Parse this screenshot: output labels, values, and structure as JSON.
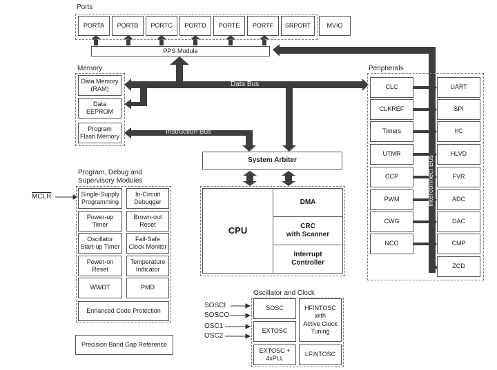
{
  "ports": {
    "label": "Ports",
    "items": [
      "PORTA",
      "PORTB",
      "PORTC",
      "PORTD",
      "PORTE",
      "PORTF",
      "SRPORT"
    ],
    "mvio": "MVIO"
  },
  "pps": "PPS Module",
  "memory": {
    "label": "Memory",
    "items": [
      {
        "line1": "Data Memory",
        "line2": "(RAM)"
      },
      {
        "line1": "Data",
        "line2": "EEPROM"
      },
      {
        "line1": "Program",
        "line2": "Flash Memory"
      }
    ]
  },
  "buses": {
    "data": "Data Bus",
    "instruction": "Instruction Bus",
    "interconnect": "Interconnect Bus"
  },
  "arbiter": "System Arbiter",
  "core": {
    "cpu": "CPU",
    "dma": "DMA",
    "crc": {
      "line1": "CRC",
      "line2": "with Scanner"
    },
    "interrupt": {
      "line1": "Interrupt",
      "line2": "Controller"
    }
  },
  "peripherals": {
    "label": "Peripherals",
    "left": [
      "CLC",
      "CLKREF",
      "Timers",
      "UTMR",
      "CCP",
      "PWM",
      "CWG",
      "NCO"
    ],
    "right": [
      "UART",
      "SPI",
      "I²C",
      "HLVD",
      "FVR",
      "ADC",
      "DAC",
      "CMP",
      "ZCD"
    ]
  },
  "supervisory": {
    "label_line1": "Program, Debug and",
    "label_line2": "Supervisory Modules",
    "mclr": "MCLR",
    "items": [
      {
        "line1": "Single-Supply",
        "line2": "Programming"
      },
      {
        "line1": "In-Circuit",
        "line2": "Debugger"
      },
      {
        "line1": "Power-up",
        "line2": "Timer"
      },
      {
        "line1": "Brown-out",
        "line2": "Reset"
      },
      {
        "line1": "Oscillator",
        "line2": "Start-up Timer"
      },
      {
        "line1": "Fail-Safe",
        "line2": "Clock Monitor"
      },
      {
        "line1": "Power-on",
        "line2": "Reset"
      },
      {
        "line1": "Temperature",
        "line2": "Indicator"
      },
      {
        "line1": "WWDT",
        "line2": ""
      },
      {
        "line1": "PMD",
        "line2": ""
      }
    ],
    "ecp": "Enhanced Code Protection"
  },
  "bandgap": "Precision Band Gap Reference",
  "oscillator": {
    "label": "Oscillator and Clock",
    "signals": [
      "SOSCI",
      "SOSCO",
      "OSC1",
      "OSC2"
    ],
    "sosc": "SOSC",
    "extosc": "EXTOSC",
    "extosc_pll": {
      "line1": "EXTOSC +",
      "line2": "4xPLL"
    },
    "hfintosc": {
      "line1": "HFINTOSC",
      "line2": "with",
      "line3": "Active Clock",
      "line4": "Tuning"
    },
    "lfintosc": "LFINTOSC"
  }
}
